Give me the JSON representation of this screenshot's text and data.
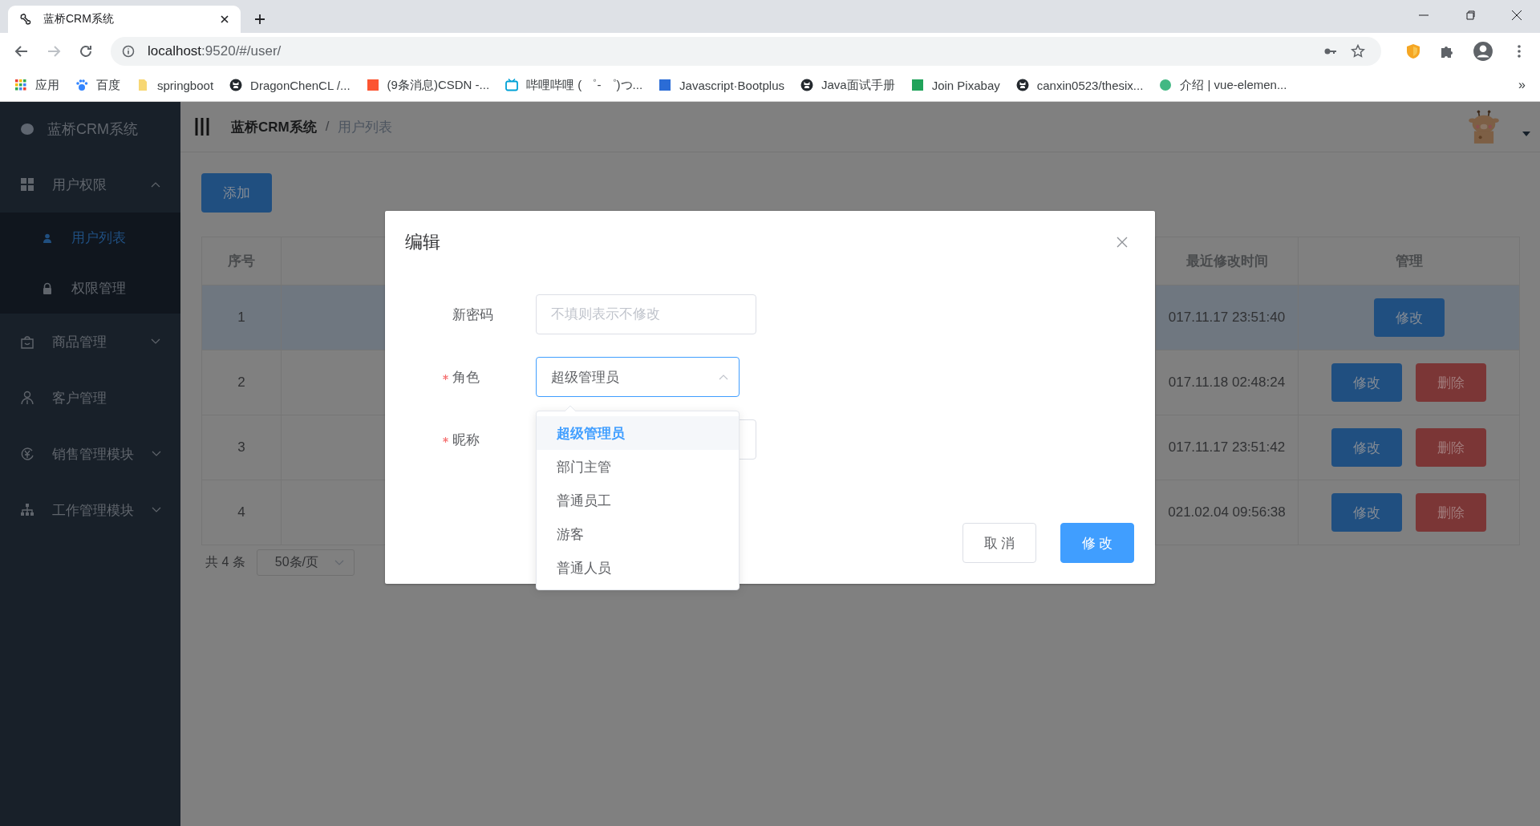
{
  "browser": {
    "tab": {
      "title": "蓝桥CRM系统"
    },
    "address": {
      "host": "localhost",
      "path": ":9520/#/user/"
    },
    "bookmarks": [
      {
        "label": "应用"
      },
      {
        "label": "百度"
      },
      {
        "label": "springboot"
      },
      {
        "label": "DragonChenCL /..."
      },
      {
        "label": "(9条消息)CSDN -..."
      },
      {
        "label": "哔哩哔哩 ( ゜- ゜)つ..."
      },
      {
        "label": "Javascript·Bootplus"
      },
      {
        "label": "Java面试手册"
      },
      {
        "label": "Join Pixabay"
      },
      {
        "label": "canxin0523/thesix..."
      },
      {
        "label": "介绍 | vue-elemen..."
      }
    ],
    "bookmarks_more": "»"
  },
  "sidebar": {
    "title": "蓝桥CRM系统",
    "items": [
      {
        "label": "用户权限",
        "kind": "submenu",
        "expanded": true,
        "children": [
          {
            "label": "用户列表",
            "selected": true
          },
          {
            "label": "权限管理",
            "selected": false
          }
        ]
      },
      {
        "label": "商品管理",
        "kind": "submenu",
        "expanded": false
      },
      {
        "label": "客户管理",
        "kind": "item"
      },
      {
        "label": "销售管理模块",
        "kind": "submenu",
        "expanded": false
      },
      {
        "label": "工作管理模块",
        "kind": "submenu",
        "expanded": false
      }
    ]
  },
  "header": {
    "breadcrumb": [
      {
        "label": "蓝桥CRM系统"
      },
      {
        "label": "用户列表"
      }
    ],
    "separator": "/"
  },
  "toolbar": {
    "add_button": "添加"
  },
  "table": {
    "columns": [
      "序号",
      "最近修改时间",
      "管理"
    ],
    "rows": [
      {
        "index": "1",
        "modified": "017.11.17 23:51:40",
        "selected": true,
        "actions": [
          {
            "label": "修改",
            "kind": "primary"
          }
        ]
      },
      {
        "index": "2",
        "modified": "017.11.18 02:48:24",
        "selected": false,
        "actions": [
          {
            "label": "修改",
            "kind": "primary"
          },
          {
            "label": "删除",
            "kind": "danger"
          }
        ]
      },
      {
        "index": "3",
        "modified": "017.11.17 23:51:42",
        "selected": false,
        "actions": [
          {
            "label": "修改",
            "kind": "primary"
          },
          {
            "label": "删除",
            "kind": "danger"
          }
        ]
      },
      {
        "index": "4",
        "modified": "021.02.04 09:56:38",
        "selected": false,
        "actions": [
          {
            "label": "修改",
            "kind": "primary"
          },
          {
            "label": "删除",
            "kind": "danger"
          }
        ]
      }
    ]
  },
  "pagination": {
    "total": "共 4 条",
    "page_size": "50条/页"
  },
  "dialog": {
    "title": "编辑",
    "fields": [
      {
        "label": "新密码",
        "required": false,
        "kind": "input",
        "placeholder": "不填则表示不修改"
      },
      {
        "label": "角色",
        "required": true,
        "kind": "select",
        "value": "超级管理员",
        "expanded": true,
        "options": [
          {
            "label": "超级管理员",
            "selected": true
          },
          {
            "label": "部门主管",
            "selected": false
          },
          {
            "label": "普通员工",
            "selected": false
          },
          {
            "label": "游客",
            "selected": false
          },
          {
            "label": "普通人员",
            "selected": false
          }
        ]
      },
      {
        "label": "昵称",
        "required": true,
        "kind": "input"
      }
    ],
    "buttons": [
      {
        "label": "取 消",
        "kind": "default"
      },
      {
        "label": "修 改",
        "kind": "primary"
      }
    ]
  }
}
